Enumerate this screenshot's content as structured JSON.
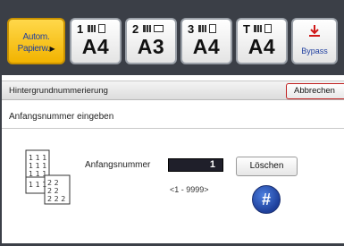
{
  "tray_bar": {
    "auto_tray": {
      "line1": "Autom.",
      "line2": "Papierw.",
      "arrow": "▶"
    },
    "trays": [
      {
        "number": "1",
        "size": "A4",
        "paper": "portrait"
      },
      {
        "number": "2",
        "size": "A3",
        "paper": "landscape"
      },
      {
        "number": "3",
        "size": "A4",
        "paper": "portrait"
      },
      {
        "number": "T",
        "size": "A4",
        "paper": "portrait"
      }
    ],
    "bypass": {
      "icon": "bypass-tray-icon",
      "label": "Bypass"
    }
  },
  "header": {
    "title": "Hintergrundnummerierung",
    "cancel_label": "Abbrechen"
  },
  "content": {
    "section_label": "Anfangsnummer eingeben",
    "start_label": "Anfangsnummer",
    "start_value": "1",
    "range_hint": "<1 - 9999>",
    "clear_label": "Löschen",
    "hash_label": "#"
  },
  "colors": {
    "accent_yellow": "#f2b300",
    "hash_button_blue": "#2a52c0",
    "cancel_border_red": "#c02020",
    "tray_bar_bg": "#3b3f47"
  }
}
